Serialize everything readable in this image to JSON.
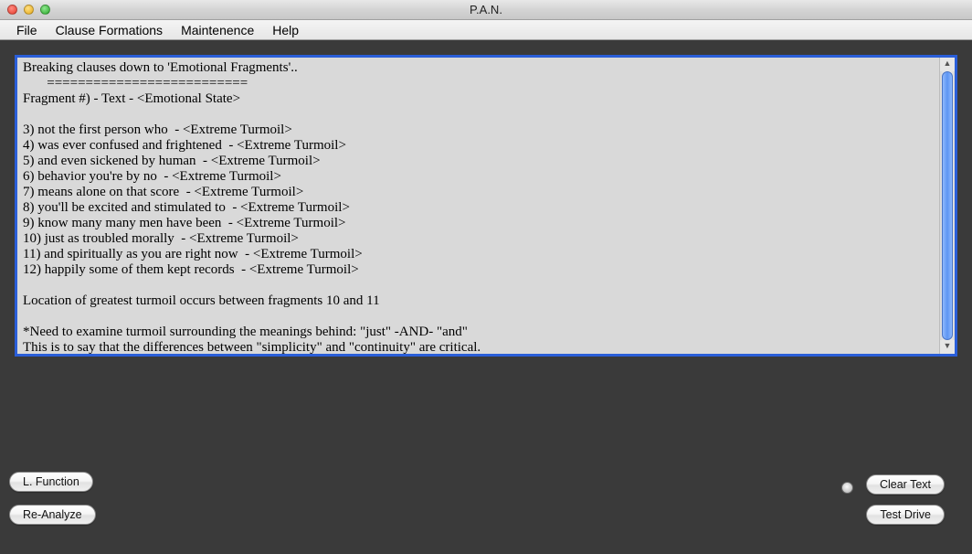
{
  "window": {
    "title": "P.A.N."
  },
  "menu": {
    "file": "File",
    "clause": "Clause Formations",
    "maint": "Maintenence",
    "help": "Help"
  },
  "output": {
    "header1": "Breaking clauses down to 'Emotional Fragments'..",
    "header2": "       ==========================",
    "header3": "Fragment #) - Text - <Emotional State>",
    "blank": "",
    "f3": "3) not the first person who  - <Extreme Turmoil>",
    "f4": "4) was ever confused and frightened  - <Extreme Turmoil>",
    "f5": "5) and even sickened by human  - <Extreme Turmoil>",
    "f6": "6) behavior you're by no  - <Extreme Turmoil>",
    "f7": "7) means alone on that score  - <Extreme Turmoil>",
    "f8": "8) you'll be excited and stimulated to  - <Extreme Turmoil>",
    "f9": "9) know many many men have been  - <Extreme Turmoil>",
    "f10": "10) just as troubled morally  - <Extreme Turmoil>",
    "f11": "11) and spiritually as you are right now  - <Extreme Turmoil>",
    "f12": "12) happily some of them kept records  - <Extreme Turmoil>",
    "loc": "Location of greatest turmoil occurs between fragments 10 and 11",
    "note1": "*Need to examine turmoil surrounding the meanings behind: \"just\" -AND- \"and\"",
    "note2": "This is to say that the differences between \"simplicity\" and \"continuity\" are critical."
  },
  "buttons": {
    "lfunction": "L. Function",
    "reanalyze": "Re-Analyze",
    "cleartext": "Clear Text",
    "testdrive": "Test Drive"
  }
}
